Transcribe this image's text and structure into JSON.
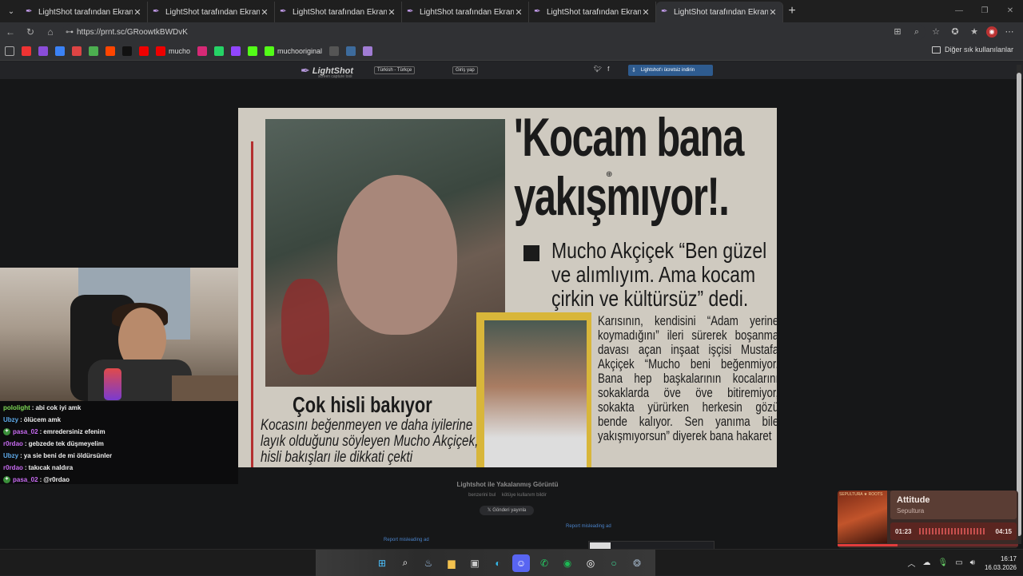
{
  "browser": {
    "tabs": [
      {
        "title": "LightShot tarafından Ekran Görüntüsü",
        "active": false
      },
      {
        "title": "LightShot tarafından Ekran Görüntüsü",
        "active": false
      },
      {
        "title": "LightShot tarafından Ekran Görüntüsü",
        "active": false
      },
      {
        "title": "LightShot tarafından Ekran Görüntüsü",
        "active": false
      },
      {
        "title": "LightShot tarafından Ekran Görüntüsü",
        "active": false
      },
      {
        "title": "LightShot tarafından Ekran Görüntüsü",
        "active": true
      }
    ],
    "url": "https://prnt.sc/GRoowtkBWDvK",
    "bookmarks": [
      {
        "label": "",
        "icon": "youtube-red",
        "color": "#e33"
      },
      {
        "label": "",
        "icon": "game",
        "color": "#8a4dd9"
      },
      {
        "label": "",
        "icon": "translate",
        "color": "#3b82f6"
      },
      {
        "label": "",
        "icon": "gmail",
        "color": "#d44"
      },
      {
        "label": "",
        "icon": "chrome",
        "color": "#4caf50"
      },
      {
        "label": "",
        "icon": "reddit",
        "color": "#ff4500"
      },
      {
        "label": "",
        "icon": "x",
        "color": "#111"
      },
      {
        "label": "",
        "icon": "youtube",
        "color": "#e00"
      },
      {
        "label": "mucho",
        "icon": "youtube",
        "color": "#e00"
      },
      {
        "label": "",
        "icon": "instagram",
        "color": "#d62976"
      },
      {
        "label": "",
        "icon": "whatsapp",
        "color": "#25d366"
      },
      {
        "label": "",
        "icon": "twitch",
        "color": "#9146ff"
      },
      {
        "label": "",
        "icon": "kick",
        "color": "#53fc18"
      },
      {
        "label": "muchooriginal",
        "icon": "kick",
        "color": "#53fc18"
      },
      {
        "label": "",
        "icon": "openai",
        "color": "#555"
      },
      {
        "label": "",
        "icon": "steam",
        "color": "#3d6b9c"
      },
      {
        "label": "",
        "icon": "feather",
        "color": "#a07cd4"
      }
    ],
    "other_bookmarks": "Diğer sık kullanılanlar"
  },
  "lightshot": {
    "logo": "LightShot",
    "logo_sub": "screen capture tool",
    "language": "Türkish - Türkçe",
    "login": "Giriş yap",
    "download": "Lightshot'ı ücretsiz indirin",
    "below_title": "Lightshot ile Yakalanmış Görüntü",
    "link_similar": "benzerini bul",
    "link_report": "kötüye kullanım bildir",
    "tweet": "Gönderi yayınla",
    "report_ad": "Report misleading ad",
    "newspaper": {
      "headline_1": "'Kocam bana",
      "headline_2": "yakışmıyor!.",
      "quote": "Mucho Akçiçek “Ben güzel ve alımlıyım. Ama kocam çirkin ve kültürsüz” dedi.",
      "body": "Karısının, kendisini “Adam yerine koymadığını” ileri sürerek boşanma davası açan inşaat işçisi Mustafa Akçiçek “Mucho beni beğenmiyor. Bana hep başkalarının kocalarını sokaklarda öve öve bitiremiyor, sokakta yürürken herkesin gözü bende kalıyor. Sen yanıma bile yakışmıyorsun” diyerek bana hakaret",
      "caption_title": "Çok hisli bakıyor",
      "caption": "Kocasını beğenmeyen ve daha iyilerine layık olduğunu söyleyen Mucho Akçiçek, hisli bakışları ile dikkati çekti"
    }
  },
  "chat": [
    {
      "user": "pololight",
      "color": "#7ed957",
      "msg": "abi cok iyi amk",
      "badge": false
    },
    {
      "user": "Ubzy",
      "color": "#5da9e9",
      "msg": "ölücem amk",
      "badge": false
    },
    {
      "user": "pasa_02",
      "color": "#c86bf2",
      "msg": "emredersiniz efenim",
      "badge": true
    },
    {
      "user": "r0rdao",
      "color": "#c86bf2",
      "msg": "gebzede tek düşmeyelim",
      "badge": false
    },
    {
      "user": "Ubzy",
      "color": "#5da9e9",
      "msg": "ya sie beni de mi öldürsünler",
      "badge": false
    },
    {
      "user": "r0rdao",
      "color": "#c86bf2",
      "msg": "takıcak naldıra",
      "badge": false
    },
    {
      "user": "pasa_02",
      "color": "#c86bf2",
      "msg": "@r0rdao",
      "badge": true
    }
  ],
  "music": {
    "album_text": "SEPULTURA ★ ROOTS",
    "song": "Attitude",
    "artist": "Sepultura",
    "elapsed": "01:23",
    "duration": "04:15",
    "progress": 0.33
  },
  "taskbar": {
    "time": "16:17",
    "date": "16.03.2026"
  }
}
